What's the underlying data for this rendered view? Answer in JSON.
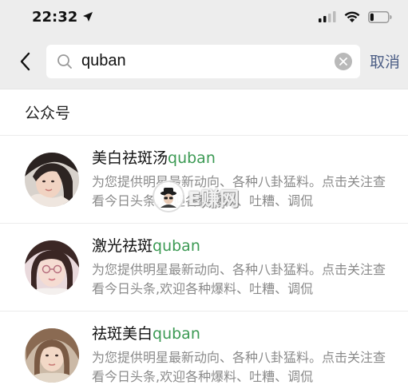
{
  "status_bar": {
    "time": "22:32",
    "location_icon": "location-arrow-icon",
    "signal_icon": "cellular-signal-icon",
    "wifi_icon": "wifi-icon",
    "battery_icon": "battery-icon",
    "battery_level": 0.2
  },
  "search": {
    "query": "quban",
    "cancel_label": "取消"
  },
  "section": {
    "title": "公众号"
  },
  "results": [
    {
      "name_prefix": "美白祛斑汤",
      "keyword": "quban",
      "description": "为您提供明星最新动向、各种八卦猛料。点击关注查看今日头条,欢迎各种爆料、吐糟、调侃",
      "avatar": "avatar-female-1"
    },
    {
      "name_prefix": "激光祛斑",
      "keyword": "quban",
      "description": "为您提供明星最新动向、各种八卦猛料。点击关注查看今日头条,欢迎各种爆料、吐糟、调侃",
      "avatar": "avatar-female-2"
    },
    {
      "name_prefix": "祛斑美白",
      "keyword": "quban",
      "description": "为您提供明星最新动向、各种八卦猛料。点击关注查看今日头条,欢迎各种爆料、吐糟、调侃",
      "avatar": "avatar-female-3"
    }
  ],
  "watermark": {
    "text": "E赚网"
  },
  "colors": {
    "header_bg": "#ededed",
    "keyword_green": "#3c9a54",
    "cancel_blue": "#4d5f86",
    "desc_gray": "#8a8a8a"
  }
}
